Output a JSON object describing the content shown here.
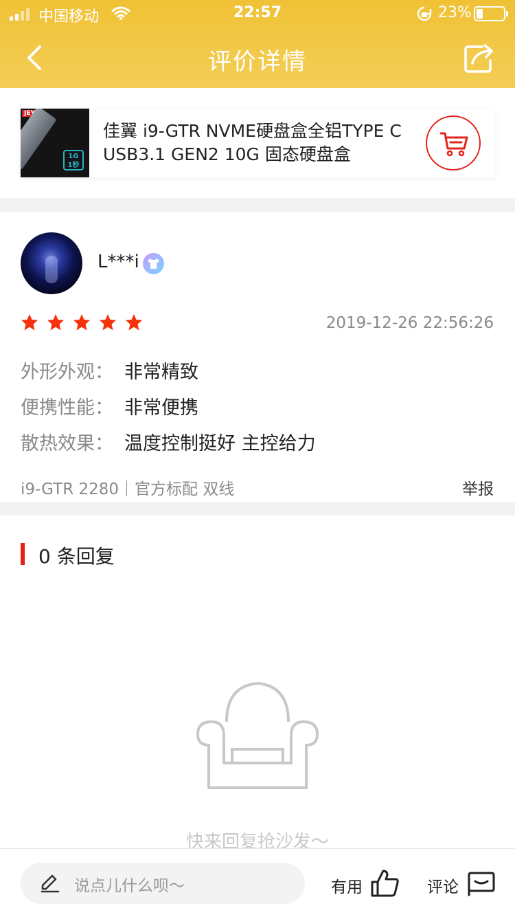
{
  "status_bar": {
    "carrier": "中国移动",
    "time": "22:57",
    "battery_percent": "23%",
    "battery_level": 0.23
  },
  "header": {
    "title": "评价详情",
    "back_icon": "chevron-left-icon",
    "share_icon": "share-icon"
  },
  "product": {
    "title": "佳翼 i9-GTR NVME硬盘盒全铝TYPE C USB3.1 GEN2 10G 固态硬盘盒",
    "thumb_brand": "JEYI",
    "thumb_badge_top": "1G",
    "thumb_badge_bottom": "1秒",
    "cart_icon": "cart-icon"
  },
  "review": {
    "username": "L***i",
    "rating": 5,
    "date": "2019-12-26 22:56:26",
    "attributes": [
      {
        "label": "外形外观：",
        "value": "非常精致"
      },
      {
        "label": "便携性能：",
        "value": "非常便携"
      },
      {
        "label": "散热效果：",
        "value": "温度控制挺好 主控给力"
      }
    ],
    "sku": "i9-GTR 2280｜官方标配 双线",
    "report_label": "举报"
  },
  "replies": {
    "count_label": "0 条回复",
    "empty_text": "快来回复抢沙发～"
  },
  "bottom_bar": {
    "input_placeholder": "说点儿什么呗～",
    "useful_label": "有用",
    "comment_label": "评论"
  },
  "colors": {
    "header": "#f2c94a",
    "accent_red": "#e2231a",
    "star": "#f4320b"
  }
}
